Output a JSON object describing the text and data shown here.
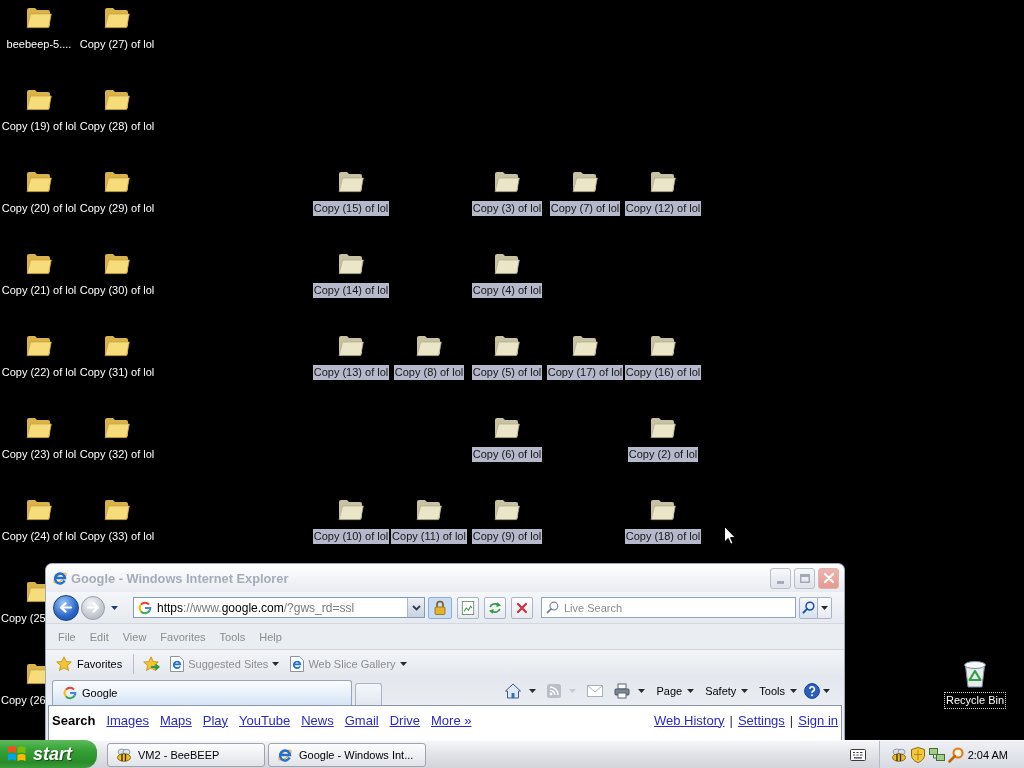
{
  "desktop": {
    "rows": [
      [
        {
          "kind": "folder",
          "label": "beebeep-5....",
          "selected": false,
          "focused": false,
          "partly_hidden": false
        },
        {
          "kind": "folder",
          "label": "Copy (27) of lol",
          "selected": false,
          "focused": false,
          "partly_hidden": false
        }
      ],
      [
        {
          "kind": "folder",
          "label": "Copy (19) of lol",
          "selected": false,
          "focused": false,
          "partly_hidden": false
        },
        {
          "kind": "folder",
          "label": "Copy (28) of lol",
          "selected": false,
          "focused": false,
          "partly_hidden": false
        }
      ],
      [
        {
          "kind": "folder",
          "label": "Copy (20) of lol",
          "selected": false,
          "focused": false,
          "partly_hidden": false
        },
        {
          "kind": "folder",
          "label": "Copy (29) of lol",
          "selected": false,
          "focused": false,
          "partly_hidden": false
        },
        null,
        null,
        {
          "kind": "folder",
          "label": "Copy (15) of lol",
          "selected": true,
          "focused": false,
          "partly_hidden": false
        },
        null,
        {
          "kind": "folder",
          "label": "Copy (3) of lol",
          "selected": true,
          "focused": false,
          "partly_hidden": false
        },
        {
          "kind": "folder",
          "label": "Copy (7) of lol",
          "selected": true,
          "focused": false,
          "partly_hidden": false
        },
        {
          "kind": "folder",
          "label": "Copy (12) of lol",
          "selected": true,
          "focused": false,
          "partly_hidden": false
        }
      ],
      [
        {
          "kind": "folder",
          "label": "Copy (21) of lol",
          "selected": false,
          "focused": false,
          "partly_hidden": false
        },
        {
          "kind": "folder",
          "label": "Copy (30) of lol",
          "selected": false,
          "focused": false,
          "partly_hidden": false
        },
        null,
        null,
        {
          "kind": "folder",
          "label": "Copy (14) of lol",
          "selected": true,
          "focused": false,
          "partly_hidden": false
        },
        null,
        {
          "kind": "folder",
          "label": "Copy (4) of lol",
          "selected": true,
          "focused": false,
          "partly_hidden": false
        }
      ],
      [
        {
          "kind": "folder",
          "label": "Copy (22) of lol",
          "selected": false,
          "focused": false,
          "partly_hidden": false
        },
        {
          "kind": "folder",
          "label": "Copy (31) of lol",
          "selected": false,
          "focused": false,
          "partly_hidden": false
        },
        null,
        null,
        {
          "kind": "folder",
          "label": "Copy (13) of lol",
          "selected": true,
          "focused": false,
          "partly_hidden": false
        },
        {
          "kind": "folder",
          "label": "Copy (8) of lol",
          "selected": true,
          "focused": false,
          "partly_hidden": false
        },
        {
          "kind": "folder",
          "label": "Copy (5) of lol",
          "selected": true,
          "focused": false,
          "partly_hidden": false
        },
        {
          "kind": "folder",
          "label": "Copy (17) of lol",
          "selected": true,
          "focused": false,
          "partly_hidden": false
        },
        {
          "kind": "folder",
          "label": "Copy (16) of lol",
          "selected": true,
          "focused": false,
          "partly_hidden": false
        }
      ],
      [
        {
          "kind": "folder",
          "label": "Copy (23) of lol",
          "selected": false,
          "focused": false,
          "partly_hidden": false
        },
        {
          "kind": "folder",
          "label": "Copy (32) of lol",
          "selected": false,
          "focused": false,
          "partly_hidden": false
        },
        null,
        null,
        null,
        null,
        {
          "kind": "folder",
          "label": "Copy (6) of lol",
          "selected": true,
          "focused": false,
          "partly_hidden": false
        },
        null,
        {
          "kind": "folder",
          "label": "Copy (2) of lol",
          "selected": true,
          "focused": false,
          "partly_hidden": false
        }
      ],
      [
        {
          "kind": "folder",
          "label": "Copy (24) of lol",
          "selected": false,
          "focused": false,
          "partly_hidden": false
        },
        {
          "kind": "folder",
          "label": "Copy (33) of lol",
          "selected": false,
          "focused": false,
          "partly_hidden": false
        },
        null,
        null,
        {
          "kind": "folder",
          "label": "Copy (10) of lol",
          "selected": true,
          "focused": false,
          "partly_hidden": false
        },
        {
          "kind": "folder",
          "label": "Copy (11) of lol",
          "selected": true,
          "focused": false,
          "partly_hidden": false
        },
        {
          "kind": "folder",
          "label": "Copy (9) of lol",
          "selected": true,
          "focused": false,
          "partly_hidden": false
        },
        null,
        {
          "kind": "folder",
          "label": "Copy (18) of lol",
          "selected": true,
          "focused": false,
          "partly_hidden": false
        }
      ],
      [
        {
          "kind": "folder",
          "label": "Copy (25",
          "selected": false,
          "focused": false,
          "partly_hidden": true
        }
      ],
      [
        {
          "kind": "folder",
          "label": "Copy (26",
          "selected": false,
          "focused": false,
          "partly_hidden": true
        },
        null,
        null,
        null,
        null,
        null,
        null,
        null,
        null,
        null,
        null,
        null,
        {
          "kind": "recycle-bin",
          "label": "Recycle Bin",
          "selected": false,
          "focused": true,
          "partly_hidden": false
        }
      ]
    ]
  },
  "browser_window": {
    "title": "Google - Windows Internet Explorer",
    "active": false,
    "address": {
      "parts": [
        {
          "text": "https",
          "strong": true
        },
        {
          "text": "://www.",
          "strong": false
        },
        {
          "text": "google.com",
          "strong": true
        },
        {
          "text": "/?gws_rd=ssl",
          "strong": false
        }
      ]
    },
    "search": {
      "placeholder": "Live Search"
    },
    "menu": [
      "File",
      "Edit",
      "View",
      "Favorites",
      "Tools",
      "Help"
    ],
    "favorites_bar": {
      "label": "Favorites",
      "links": [
        "Suggested Sites",
        "Web Slice Gallery"
      ]
    },
    "tabs": [
      {
        "label": "Google",
        "selected": true
      }
    ],
    "command_bar": {
      "feeds": {
        "disabled": true
      },
      "mail": {
        "disabled": true
      },
      "menus": [
        "Page",
        "Safety",
        "Tools"
      ]
    },
    "page": {
      "current": "Search",
      "links": [
        "Images",
        "Maps",
        "Play",
        "YouTube",
        "News",
        "Gmail",
        "Drive",
        "More »"
      ],
      "account_links": [
        {
          "kind": "link",
          "label": "Web History"
        },
        {
          "kind": "separator",
          "label": "|"
        },
        {
          "kind": "link",
          "label": "Settings"
        },
        {
          "kind": "separator",
          "label": "|"
        },
        {
          "kind": "link",
          "label": "Sign in"
        }
      ]
    }
  },
  "taskbar": {
    "start": "start",
    "buttons": [
      {
        "kind": "messenger",
        "label": "VM2 - BeeBEEP"
      },
      {
        "kind": "browser",
        "label": "Google - Windows Int..."
      }
    ],
    "clock": "2:04 AM"
  }
}
